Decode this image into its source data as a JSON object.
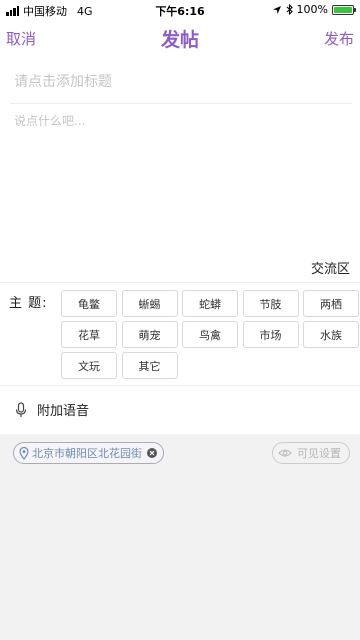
{
  "status": {
    "carrier": "中国移动",
    "network": "4G",
    "time": "下午6:16",
    "battery": "100%",
    "battery_level": 1.0
  },
  "nav": {
    "cancel": "取消",
    "title": "发帖",
    "publish": "发布"
  },
  "form": {
    "title_placeholder": "请点击添加标题",
    "body_placeholder": "说点什么吧...",
    "category": "交流区"
  },
  "topic": {
    "label": "主 题:",
    "tags": [
      "龟鳖",
      "蜥蜴",
      "蛇蟒",
      "节肢",
      "两栖",
      "花草",
      "萌宠",
      "鸟禽",
      "市场",
      "水族",
      "文玩",
      "其它"
    ]
  },
  "voice": {
    "label": "附加语音"
  },
  "location": {
    "text": "北京市朝阳区北花园街"
  },
  "visibility": {
    "label": "可见设置"
  },
  "colors": {
    "accent": "#8e5cc7",
    "location_text": "#6f8ab5",
    "battery": "#39c53b"
  },
  "icons": [
    "signal-icon",
    "location-arrow-icon",
    "bluetooth-icon",
    "battery-icon",
    "microphone-icon",
    "map-pin-icon",
    "clear-icon",
    "eye-icon"
  ]
}
